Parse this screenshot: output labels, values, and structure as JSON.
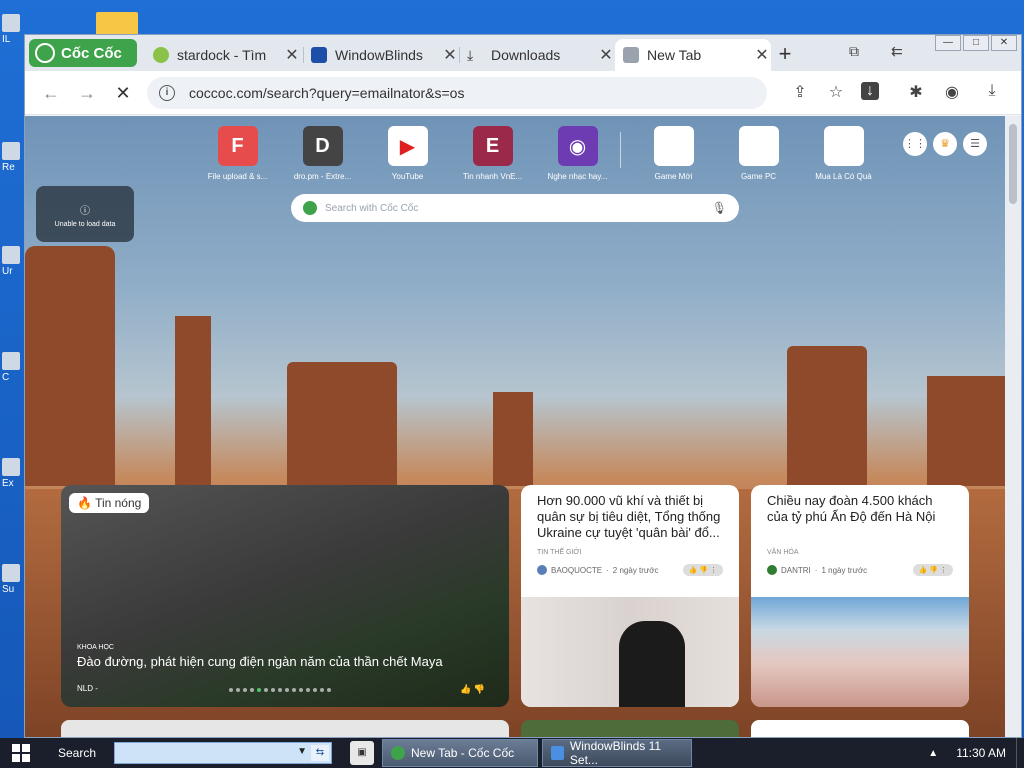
{
  "desktop": {
    "icons": [
      {
        "name": "desktop-icon-1",
        "label": "IL"
      },
      {
        "name": "desktop-icon-2",
        "label": "Re"
      },
      {
        "name": "desktop-icon-3",
        "label": "Ur"
      },
      {
        "name": "desktop-icon-4",
        "label": "C"
      },
      {
        "name": "desktop-icon-5",
        "label": "Ex"
      },
      {
        "name": "desktop-icon-6",
        "label": "Su"
      }
    ]
  },
  "browser": {
    "brand": "Cốc Cốc",
    "tabs": [
      {
        "title": "stardock - Tìm",
        "icon": "coccoc-leaf-icon"
      },
      {
        "title": "WindowBlinds",
        "icon": "stardock-icon"
      },
      {
        "title": "Downloads",
        "icon": "download-icon"
      },
      {
        "title": "New Tab",
        "icon": "page-icon"
      }
    ],
    "new_tab_symbol": "+",
    "window_buttons": [
      "—",
      "□",
      "✕"
    ],
    "url": "coccoc.com/search?query=emailnator&s=os"
  },
  "speed_dial": [
    {
      "label": "File upload & s...",
      "letter": "F",
      "color": "#e74c4c"
    },
    {
      "label": "dro.pm - Extre...",
      "letter": "D",
      "color": "#444444"
    },
    {
      "label": "YouTube",
      "letter": "▶",
      "color": "#ffffff"
    },
    {
      "label": "Tin nhanh VnE...",
      "letter": "E",
      "color": "#9b2a4a"
    },
    {
      "label": "Nghe nhạc hay...",
      "letter": "◉",
      "color": "#6d3cb3"
    },
    {
      "label": "Game Mới",
      "letter": "",
      "color": "#ffffff"
    },
    {
      "label": "Game PC",
      "letter": "",
      "color": "#ffffff"
    },
    {
      "label": "Mua Là Có Quà",
      "letter": "",
      "color": "#ffffff"
    }
  ],
  "unable_message": "Unable to load data",
  "search": {
    "placeholder": "Search with Cốc Cốc"
  },
  "hot_news": {
    "badge": "Tin nóng",
    "category": "KHOA HỌC",
    "title": "Đào đường, phát hiện cung điện ngàn năm của thần chết Maya",
    "source": "NLD -"
  },
  "news": [
    {
      "title": "Hơn 90.000 vũ khí và thiết bị quân sự bị tiêu diệt, Tổng thống Ukraine cự tuyệt 'quân bài' đổ...",
      "category": "TIN THẾ GIỚI",
      "source": "BAOQUOCTE",
      "time": "2 ngày trước"
    },
    {
      "title": "Chiều nay đoàn 4.500 khách của tỷ phú Ấn Độ đến Hà Nội",
      "category": "VĂN HÓA",
      "source": "DANTRI",
      "time": "1 ngày trước"
    }
  ],
  "taskbar": {
    "search_label": "Search",
    "tasks": [
      {
        "title": "New Tab - Cốc Cốc"
      },
      {
        "title": "WindowBlinds 11 Set..."
      }
    ],
    "clock": "11:30 AM"
  },
  "colors": {
    "brand_green": "#3ea34a",
    "taskbar": "#1a1f2b"
  }
}
